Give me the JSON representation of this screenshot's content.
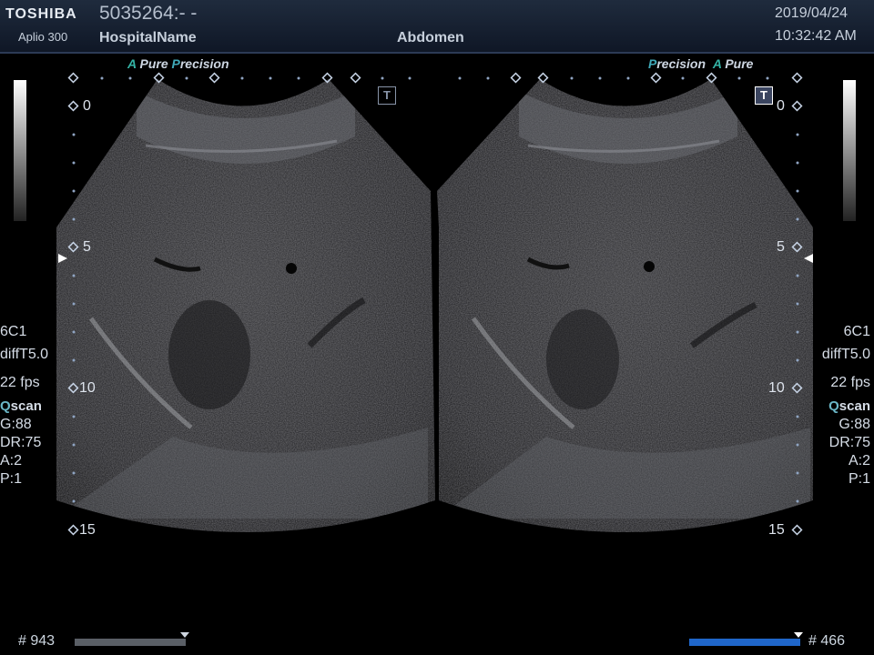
{
  "header": {
    "brand": "TOSHIBA",
    "model": "Aplio 300",
    "patient_id": "5035264:- -",
    "hospital": "HospitalName",
    "exam": "Abdomen",
    "date": "2019/04/24",
    "time": "10:32:42 AM"
  },
  "left_panel": {
    "logo_a": "A",
    "logo_pure": "Pure",
    "logo_p": "P",
    "logo_precision": "recision",
    "t_marker": "T",
    "depth_labels": [
      "0",
      "5",
      "10",
      "15"
    ],
    "params": {
      "probe": "6C1",
      "freq": "diffT5.0",
      "fps": "22 fps",
      "qscan_q": "Q",
      "qscan_s": "scan",
      "gain": "G:88",
      "dr": "DR:75",
      "a": "A:2",
      "p": "P:1"
    },
    "frame_count": "# 943"
  },
  "right_panel": {
    "logo_p": "P",
    "logo_precision": "recision",
    "logo_a": "A",
    "logo_pure": "Pure",
    "t_marker": "T",
    "depth_labels": [
      "0",
      "5",
      "10",
      "15"
    ],
    "params": {
      "probe": "6C1",
      "freq": "diffT5.0",
      "fps": "22 fps",
      "qscan_q": "Q",
      "qscan_s": "scan",
      "gain": "G:88",
      "dr": "DR:75",
      "a": "A:2",
      "p": "P:1"
    },
    "frame_count": "# 466"
  },
  "colors": {
    "header_bg": "#1a2436",
    "accent_teal": "#34b3a5",
    "cine_active": "#1f66c9",
    "cine_inactive": "#5a5f66"
  }
}
